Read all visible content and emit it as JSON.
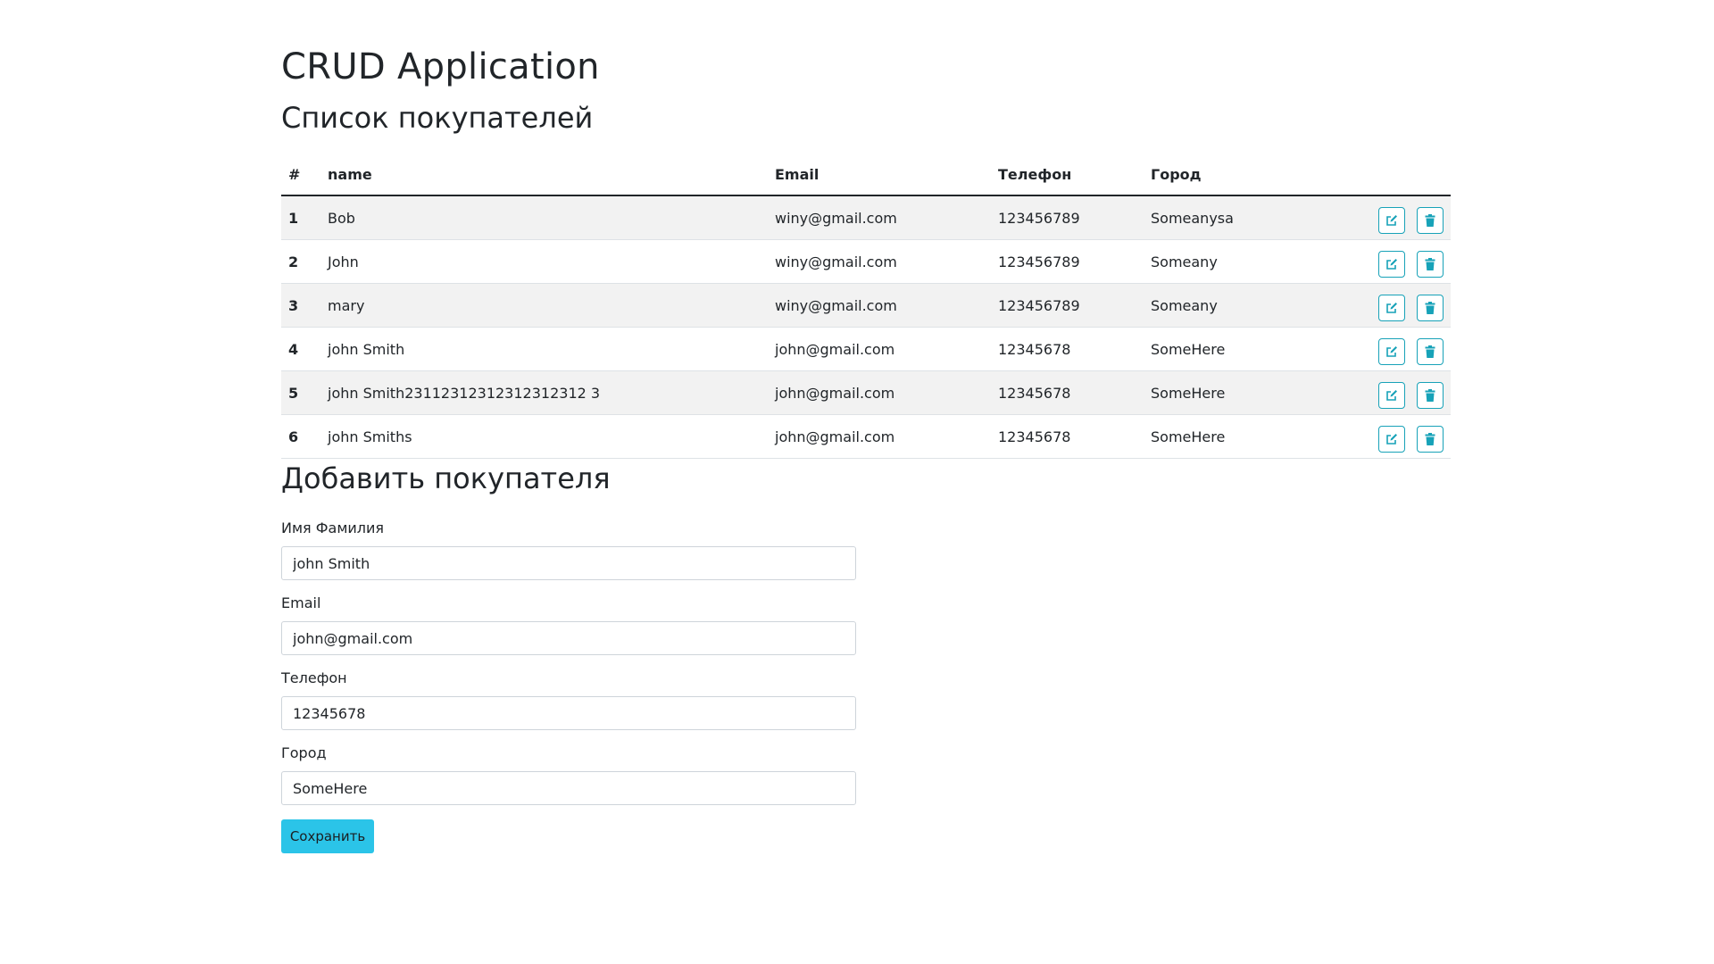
{
  "app": {
    "title": "CRUD Application"
  },
  "list": {
    "title": "Список покупателей",
    "columns": [
      "#",
      "name",
      "Email",
      "Телефон",
      "Город"
    ],
    "rows": [
      {
        "num": "1",
        "name": "Bob",
        "email": "winy@gmail.com",
        "phone": "123456789",
        "city": "Someanysa"
      },
      {
        "num": "2",
        "name": "John",
        "email": "winy@gmail.com",
        "phone": "123456789",
        "city": "Someany"
      },
      {
        "num": "3",
        "name": "mary",
        "email": "winy@gmail.com",
        "phone": "123456789",
        "city": "Someany"
      },
      {
        "num": "4",
        "name": "john Smith",
        "email": "john@gmail.com",
        "phone": "12345678",
        "city": "SomeHere"
      },
      {
        "num": "5",
        "name": "john Smith23112312312312312312 3",
        "email": "john@gmail.com",
        "phone": "12345678",
        "city": "SomeHere"
      },
      {
        "num": "6",
        "name": "john Smiths",
        "email": "john@gmail.com",
        "phone": "12345678",
        "city": "SomeHere"
      }
    ],
    "row_actions": [
      "edit-icon",
      "trash-icon"
    ]
  },
  "form": {
    "title": "Добавить покупателя",
    "name_label": "Имя Фамилия",
    "name_value": "john Smith",
    "email_label": "Email",
    "email_value": "john@gmail.com",
    "phone_label": "Телефон",
    "phone_value": "12345678",
    "city_label": "Город",
    "city_value": "SomeHere",
    "save_label": "Сохранить"
  },
  "colors": {
    "accent": "#17a2b8",
    "save_button": "#2bc4e8",
    "stripe": "#f2f2f2"
  }
}
